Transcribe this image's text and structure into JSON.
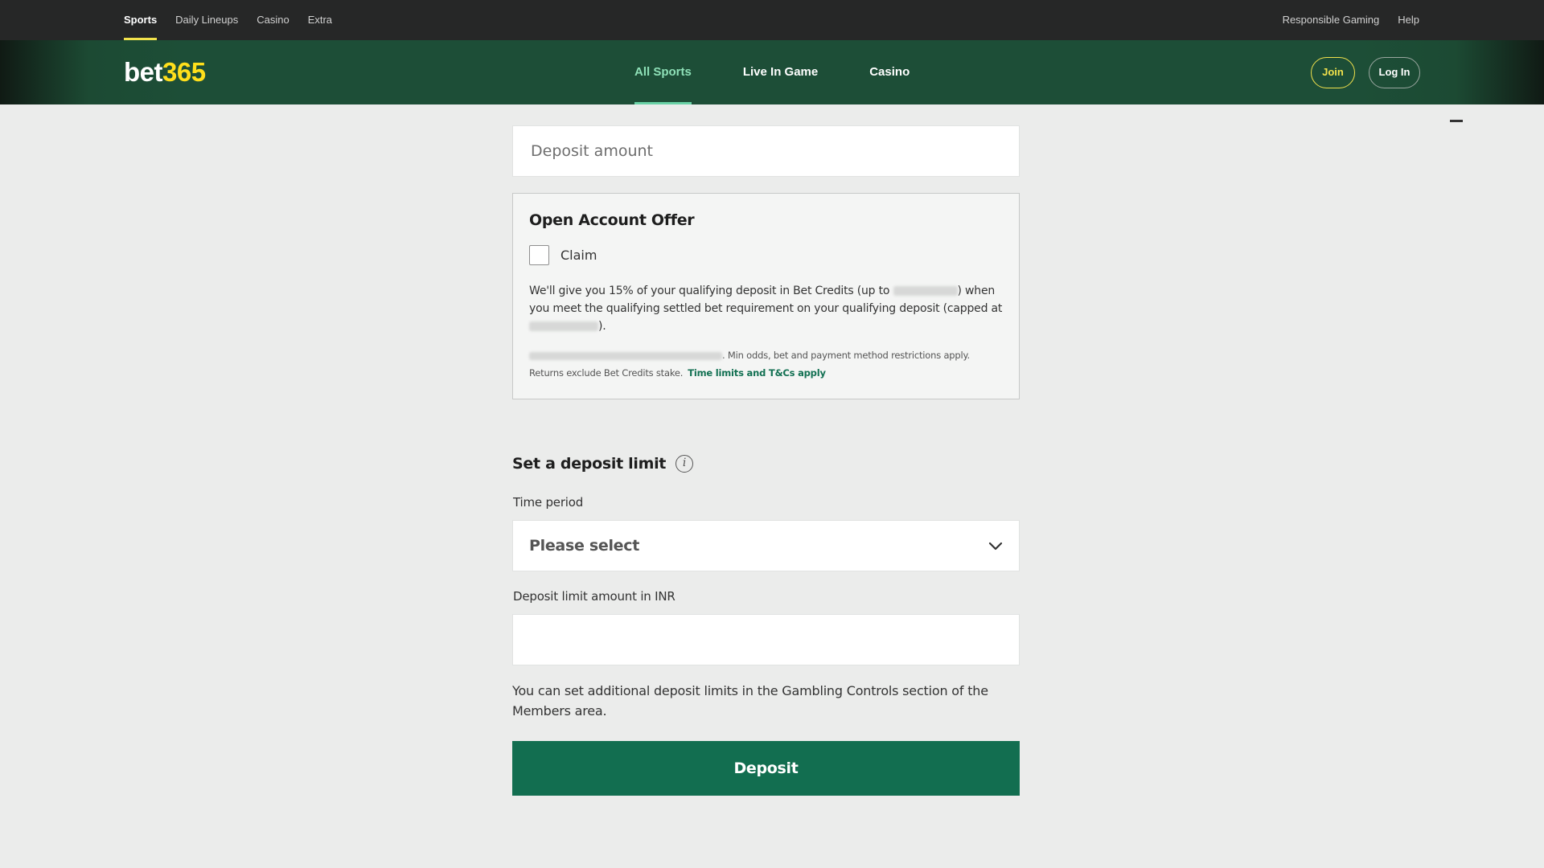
{
  "topbar": {
    "left_items": [
      "Sports",
      "Daily Lineups",
      "Casino",
      "Extra"
    ],
    "right_items": [
      "Responsible Gaming",
      "Help"
    ]
  },
  "header": {
    "logo_part1": "bet",
    "logo_part2": "365",
    "nav": [
      "All Sports",
      "Live In Game",
      "Casino"
    ],
    "join_label": "Join",
    "login_label": "Log In"
  },
  "deposit": {
    "amount_placeholder": "Deposit amount"
  },
  "offer": {
    "title": "Open Account Offer",
    "claim_label": "Claim",
    "text_a": "We'll give you 15% of your qualifying deposit in Bet Credits (up to ",
    "text_b": ") when you meet the qualifying settled bet requirement on your qualifying deposit (capped at ",
    "text_c": ").",
    "small_a": ". Min odds, bet and payment method restrictions apply. Returns exclude Bet Credits stake.",
    "tc_link": "Time limits and T&Cs apply"
  },
  "limit": {
    "section_title": "Set a deposit limit",
    "info_glyph": "i",
    "time_period_label": "Time period",
    "time_period_value": "Please select",
    "amount_label": "Deposit limit amount in INR",
    "note": "You can set additional deposit limits in the Gambling Controls section of the Members area."
  },
  "deposit_button": "Deposit",
  "colors": {
    "topbar_bg": "#262727",
    "header_green": "#1d4e37",
    "accent_yellow": "#f2e24c",
    "active_nav": "#8ee0b7",
    "deposit_button": "#126e50",
    "page_bg": "#ebeceb"
  }
}
